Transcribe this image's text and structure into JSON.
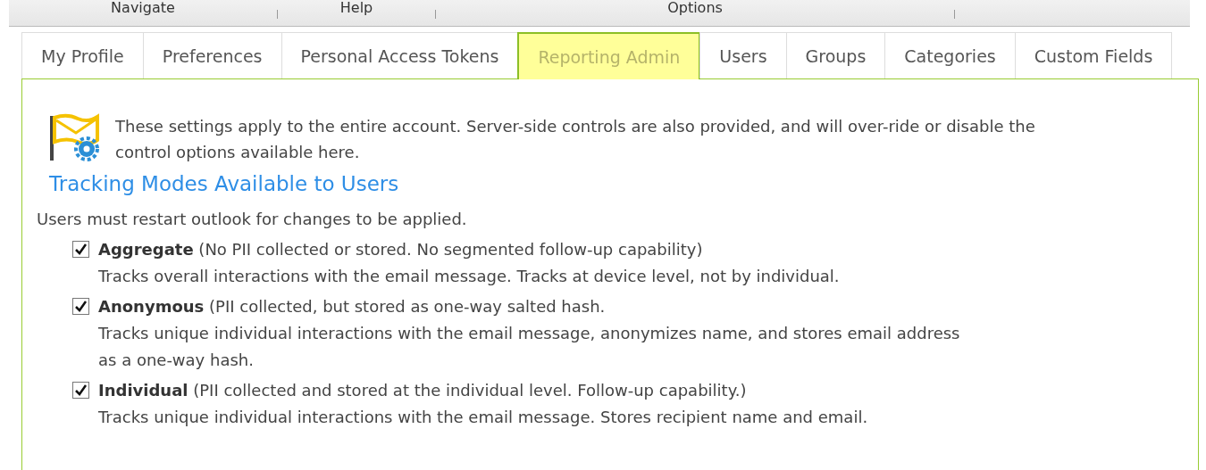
{
  "menu": [
    {
      "label": "Navigate"
    },
    {
      "label": "Help"
    },
    {
      "label": "Options"
    }
  ],
  "tabs": [
    {
      "label": "My Profile",
      "selected": false
    },
    {
      "label": "Preferences",
      "selected": false
    },
    {
      "label": "Personal Access Tokens",
      "selected": false
    },
    {
      "label": "Reporting Admin",
      "selected": true
    },
    {
      "label": "Users",
      "selected": false
    },
    {
      "label": "Groups",
      "selected": false
    },
    {
      "label": "Categories",
      "selected": false
    },
    {
      "label": "Custom Fields",
      "selected": false
    }
  ],
  "intro": "These settings apply to the entire account. Server-side controls are also provided, and will over-ride or disable the control options available here.",
  "section_title": "Tracking Modes Available to Users",
  "note": "Users must restart outlook for changes to be applied.",
  "modes": [
    {
      "label": "**Aggregate** (No PII collected or stored. No segmented follow-up capability)",
      "description": "Tracks overall interactions with the email message. Tracks at device level, not by individual.",
      "checked": true
    },
    {
      "label": "**Anonymous** (PII collected, but stored as one-way salted hash.",
      "description": "Tracks unique individual interactions with the email message, anonymizes name, and stores email address as a one-way hash.",
      "checked": true
    },
    {
      "label": "**Individual** (PII collected and stored at the individual level. Follow-up capability.)",
      "description": "Tracks unique individual interactions with the email message. Stores recipient name and email.",
      "checked": true
    }
  ]
}
